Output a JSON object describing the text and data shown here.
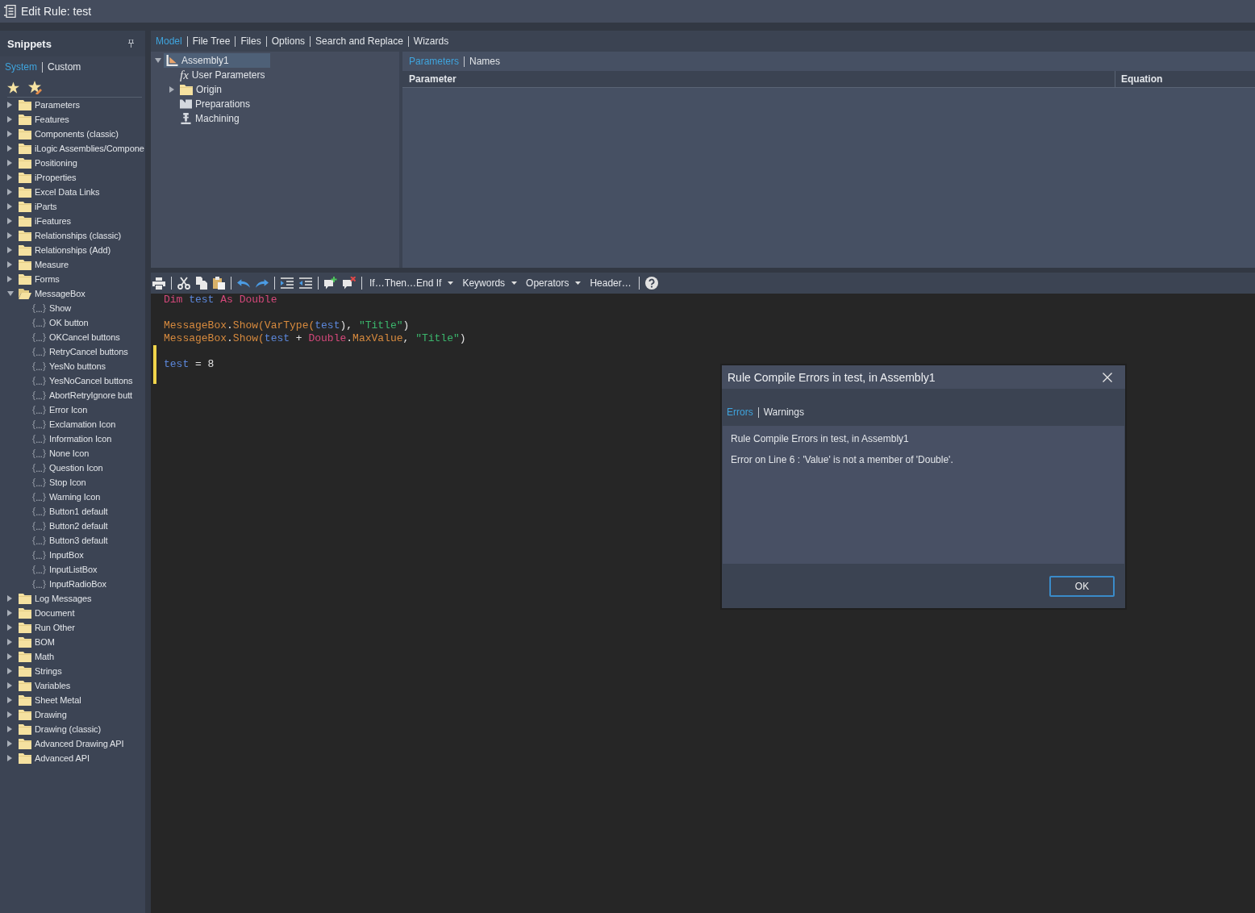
{
  "window": {
    "title": "Edit Rule: test"
  },
  "snippets": {
    "title": "Snippets",
    "tabs": [
      {
        "label": "System",
        "selected": true
      },
      {
        "label": "Custom",
        "selected": false
      }
    ],
    "tree": [
      {
        "label": "Parameters",
        "expanded": false
      },
      {
        "label": "Features",
        "expanded": false
      },
      {
        "label": "Components (classic)",
        "expanded": false
      },
      {
        "label": "iLogic Assemblies/Compone",
        "expanded": false
      },
      {
        "label": "Positioning",
        "expanded": false
      },
      {
        "label": "iProperties",
        "expanded": false
      },
      {
        "label": "Excel Data Links",
        "expanded": false
      },
      {
        "label": "iParts",
        "expanded": false
      },
      {
        "label": "iFeatures",
        "expanded": false
      },
      {
        "label": "Relationships (classic)",
        "expanded": false
      },
      {
        "label": "Relationships (Add)",
        "expanded": false
      },
      {
        "label": "Measure",
        "expanded": false
      },
      {
        "label": "Forms",
        "expanded": false
      },
      {
        "label": "MessageBox",
        "expanded": true,
        "children": [
          {
            "label": "Show"
          },
          {
            "label": "OK button"
          },
          {
            "label": "OKCancel buttons"
          },
          {
            "label": "RetryCancel buttons"
          },
          {
            "label": "YesNo buttons"
          },
          {
            "label": "YesNoCancel buttons"
          },
          {
            "label": "AbortRetryIgnore butt"
          },
          {
            "label": "Error Icon"
          },
          {
            "label": "Exclamation Icon"
          },
          {
            "label": "Information Icon"
          },
          {
            "label": "None Icon"
          },
          {
            "label": "Question Icon"
          },
          {
            "label": "Stop Icon"
          },
          {
            "label": "Warning Icon"
          },
          {
            "label": "Button1 default"
          },
          {
            "label": "Button2 default"
          },
          {
            "label": "Button3 default"
          },
          {
            "label": "InputBox"
          },
          {
            "label": "InputListBox"
          },
          {
            "label": "InputRadioBox"
          }
        ]
      },
      {
        "label": "Log Messages",
        "expanded": false
      },
      {
        "label": "Document",
        "expanded": false
      },
      {
        "label": "Run Other",
        "expanded": false
      },
      {
        "label": "BOM",
        "expanded": false
      },
      {
        "label": "Math",
        "expanded": false
      },
      {
        "label": "Strings",
        "expanded": false
      },
      {
        "label": "Variables",
        "expanded": false
      },
      {
        "label": "Sheet Metal",
        "expanded": false
      },
      {
        "label": "Drawing",
        "expanded": false
      },
      {
        "label": "Drawing (classic)",
        "expanded": false
      },
      {
        "label": "Advanced Drawing API",
        "expanded": false
      },
      {
        "label": "Advanced API",
        "expanded": false
      }
    ]
  },
  "main_tabs": [
    {
      "label": "Model",
      "selected": true
    },
    {
      "label": "File Tree",
      "selected": false
    },
    {
      "label": "Files",
      "selected": false
    },
    {
      "label": "Options",
      "selected": false
    },
    {
      "label": "Search and Replace",
      "selected": false
    },
    {
      "label": "Wizards",
      "selected": false
    }
  ],
  "model_tree": [
    {
      "label": "Assembly1",
      "kind": "assembly",
      "expanded": true,
      "selected": true,
      "children": [
        {
          "label": "User Parameters",
          "kind": "parameters",
          "glyph": "fx",
          "selected": false
        },
        {
          "label": "Origin",
          "kind": "folder",
          "expanded": false,
          "selected": false
        },
        {
          "label": "Preparations",
          "kind": "preparations",
          "selected": false
        },
        {
          "label": "Machining",
          "kind": "machining",
          "selected": false
        }
      ]
    }
  ],
  "parameters_panel": {
    "tabs": [
      {
        "label": "Parameters",
        "selected": true
      },
      {
        "label": "Names",
        "selected": false
      }
    ],
    "columns": [
      "Parameter",
      "Equation"
    ]
  },
  "toolbar": {
    "menus": [
      {
        "label": "If…Then…End If",
        "has_menu": true
      },
      {
        "label": "Keywords",
        "has_menu": true
      },
      {
        "label": "Operators",
        "has_menu": true
      },
      {
        "label": "Header…",
        "has_menu": false
      }
    ]
  },
  "editor": {
    "lines": [
      {
        "kind": "code",
        "changed": false,
        "tokens": [
          {
            "kind": "keyword",
            "text": "Dim "
          },
          {
            "kind": "variable",
            "text": "test "
          },
          {
            "kind": "keyword",
            "text": "As Double"
          }
        ]
      },
      {
        "kind": "blank",
        "changed": false
      },
      {
        "kind": "code",
        "changed": false,
        "tokens": [
          {
            "kind": "method",
            "text": "MessageBox"
          },
          {
            "kind": "plain",
            "text": "."
          },
          {
            "kind": "method",
            "text": "Show(VarType("
          },
          {
            "kind": "variable",
            "text": "test"
          },
          {
            "kind": "plain",
            "text": "), "
          },
          {
            "kind": "string",
            "text": "\"Title\""
          },
          {
            "kind": "plain",
            "text": ")"
          }
        ]
      },
      {
        "kind": "code",
        "changed": false,
        "tokens": [
          {
            "kind": "method",
            "text": "MessageBox"
          },
          {
            "kind": "plain",
            "text": "."
          },
          {
            "kind": "method",
            "text": "Show("
          },
          {
            "kind": "variable",
            "text": "test"
          },
          {
            "kind": "plain",
            "text": " + "
          },
          {
            "kind": "keyword",
            "text": "Double"
          },
          {
            "kind": "plain",
            "text": "."
          },
          {
            "kind": "method",
            "text": "MaxValue"
          },
          {
            "kind": "plain",
            "text": ", "
          },
          {
            "kind": "string",
            "text": "\"Title\""
          },
          {
            "kind": "plain",
            "text": ")"
          }
        ]
      },
      {
        "kind": "blank",
        "changed": true
      },
      {
        "kind": "code",
        "changed": true,
        "tokens": [
          {
            "kind": "variable",
            "text": "test"
          },
          {
            "kind": "plain",
            "text": " = 8"
          }
        ]
      },
      {
        "kind": "blank",
        "changed": true
      }
    ]
  },
  "dialog": {
    "title": "Rule Compile Errors in test, in Assembly1",
    "tabs": [
      {
        "label": "Errors",
        "selected": true
      },
      {
        "label": "Warnings",
        "selected": false
      }
    ],
    "messages": [
      "Rule Compile Errors in test, in Assembly1",
      "Error on Line 6 : 'Value' is not a member of 'Double'."
    ],
    "buttons": [
      "OK"
    ]
  }
}
